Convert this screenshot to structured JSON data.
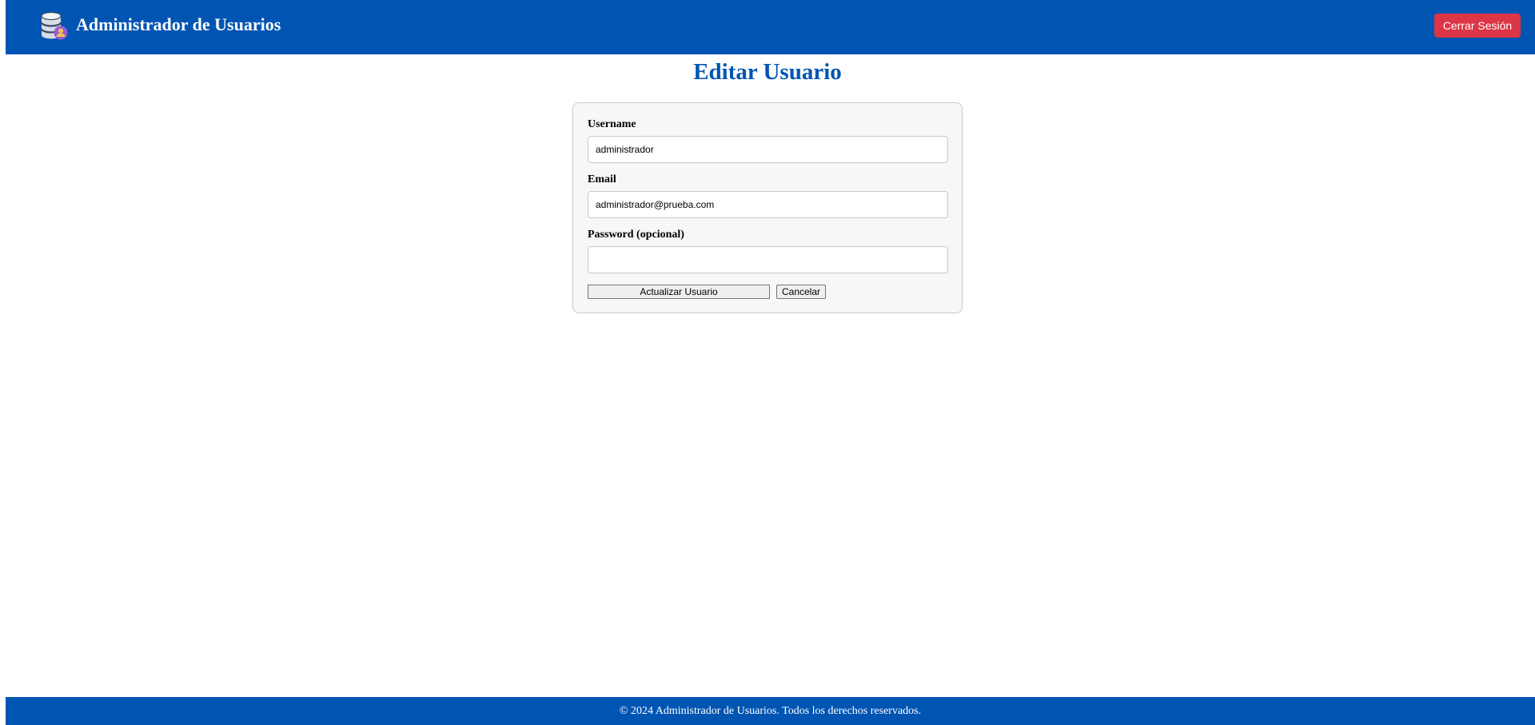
{
  "header": {
    "logo_icon": "database-user-icon",
    "title": "Administrador de Usuarios",
    "logout_label": "Cerrar Sesión",
    "bg_color": "#0055b3",
    "logout_color": "#dc3545"
  },
  "main": {
    "title": "Editar Usuario"
  },
  "form": {
    "username": {
      "label": "Username",
      "value": "administrador"
    },
    "email": {
      "label": "Email",
      "value": "administrador@prueba.com"
    },
    "password": {
      "label": "Password (opcional)",
      "value": ""
    },
    "update_label": "Actualizar Usuario",
    "cancel_label": "Cancelar"
  },
  "footer": {
    "text": "© 2024 Administrador de Usuarios. Todos los derechos reservados."
  }
}
